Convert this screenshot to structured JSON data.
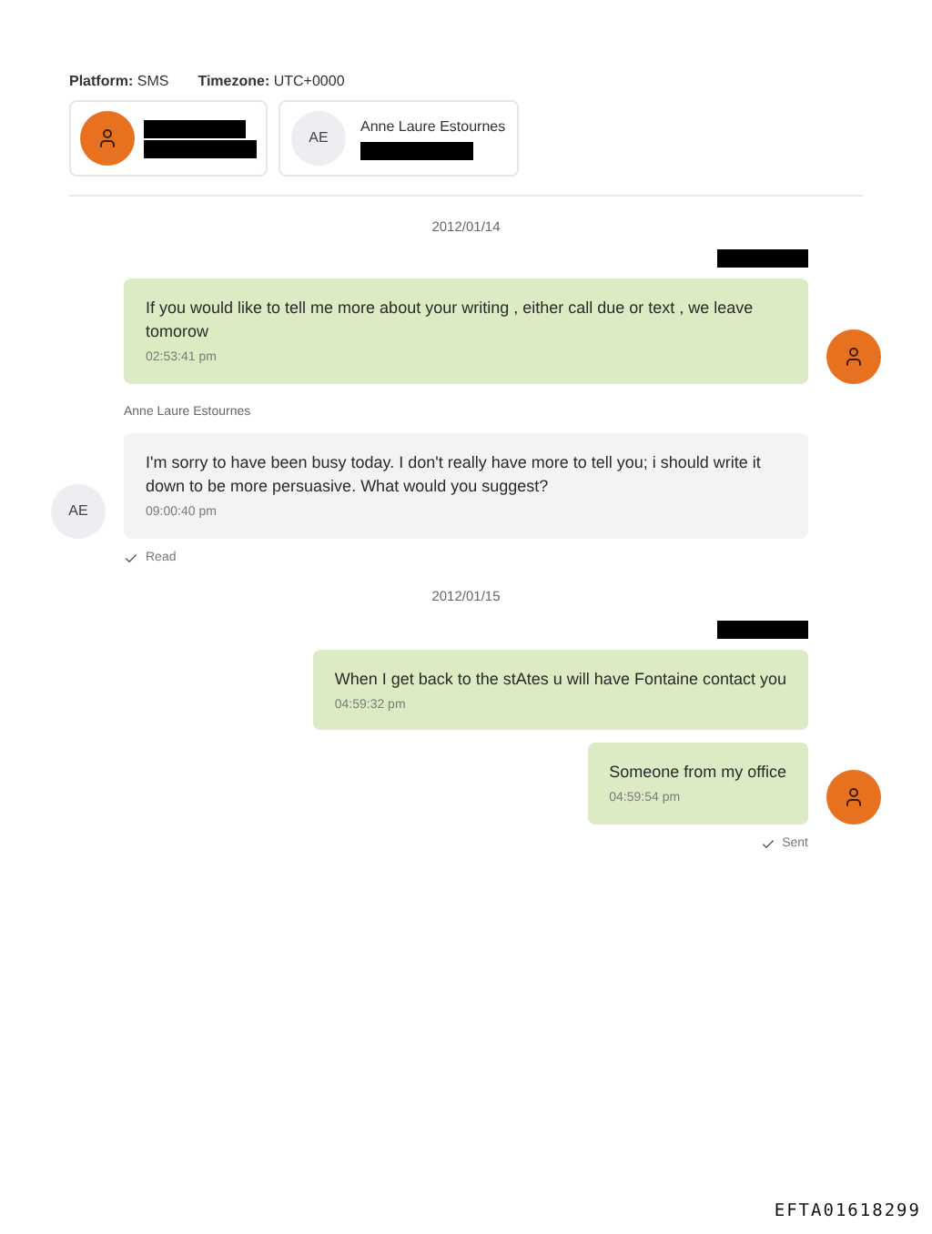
{
  "header": {
    "platform_label": "Platform:",
    "platform": "SMS",
    "timezone_label": "Timezone:",
    "timezone": "UTC+0000"
  },
  "participants": [
    {
      "kind": "owner"
    },
    {
      "kind": "contact",
      "initials": "AE",
      "name": "Anne Laure Estournes"
    }
  ],
  "days": [
    {
      "date": "2012/01/14",
      "messages": [
        {
          "kind": "outgoing",
          "sender_redacted": true,
          "text": "If you would like to tell me more about your writing , either call due or text , we leave tomorow",
          "time": "02:53:41 pm",
          "avatar": true
        },
        {
          "kind": "incoming",
          "sender": "Anne Laure Estournes",
          "initials": "AE",
          "text": "I'm sorry to have been busy today. I don't really have more to tell you; i should write it down to be more persuasive. What would you suggest?",
          "time": "09:00:40 pm",
          "avatar": true,
          "status": "Read"
        }
      ]
    },
    {
      "date": "2012/01/15",
      "messages": [
        {
          "kind": "outgoing",
          "sender_redacted": true,
          "text": "When I get back to the stAtes u will have Fontaine contact you",
          "time": "04:59:32 pm",
          "avatar": false
        },
        {
          "kind": "outgoing",
          "sender_redacted": false,
          "text": "Someone from my office",
          "time": "04:59:54 pm",
          "avatar": true,
          "status": "Sent"
        }
      ]
    }
  ],
  "document_id": "EFTA01618299"
}
